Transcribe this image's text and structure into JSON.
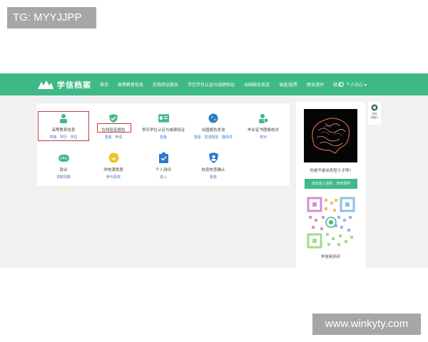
{
  "watermark_top": "TG: MYYJJPP",
  "watermark_bottom": "www.winkyty.com",
  "header": {
    "logo_text": "学信档案",
    "nav": [
      "首页",
      "高等教育信息",
      "在线验证报告",
      "学历学位认证与成绩验证",
      "出国报告发送",
      "调查/投票",
      "职业测评",
      "就业"
    ],
    "user_menu": "个人中心 ▾"
  },
  "tiles": [
    {
      "title": "高等教育信息",
      "links": "学籍 学历 学位",
      "icon": "person-icon",
      "color": "#3fba87"
    },
    {
      "title": "在线验证报告",
      "links": "查看 申请",
      "icon": "shield-check-icon",
      "color": "#3fba87"
    },
    {
      "title": "学历学位认证与成绩验证",
      "links": "查看",
      "icon": "id-card-icon",
      "color": "#3fba87"
    },
    {
      "title": "出国报告发送",
      "links": "查看 发送报告 翻译件",
      "icon": "globe-icon",
      "color": "#2b7ad1"
    },
    {
      "title": "毕业证书图像校对",
      "links": "校对",
      "icon": "user-check-icon",
      "color": "#3fba87"
    },
    {
      "title": "就业",
      "links": "求职招聘",
      "icon": "offer-icon",
      "badge": "Offer",
      "color": "#3fba87"
    },
    {
      "title": "学校满意度",
      "links": "参与投票",
      "icon": "smiley-icon",
      "color": "#f2c12e"
    },
    {
      "title": "个人测评",
      "links": "进入",
      "icon": "clipboard-check-icon",
      "color": "#2b7ad1"
    },
    {
      "title": "信息核查确认",
      "links": "查看",
      "icon": "user-shield-icon",
      "color": "#2b7ad1"
    }
  ],
  "sidebar": {
    "question": "你是不是出色型人才呢?",
    "button": "点击进入测评，开启测评",
    "qr_label": "学信网测评"
  },
  "float_widget": {
    "label_line1": "学信",
    "label_line2": "机器人"
  }
}
